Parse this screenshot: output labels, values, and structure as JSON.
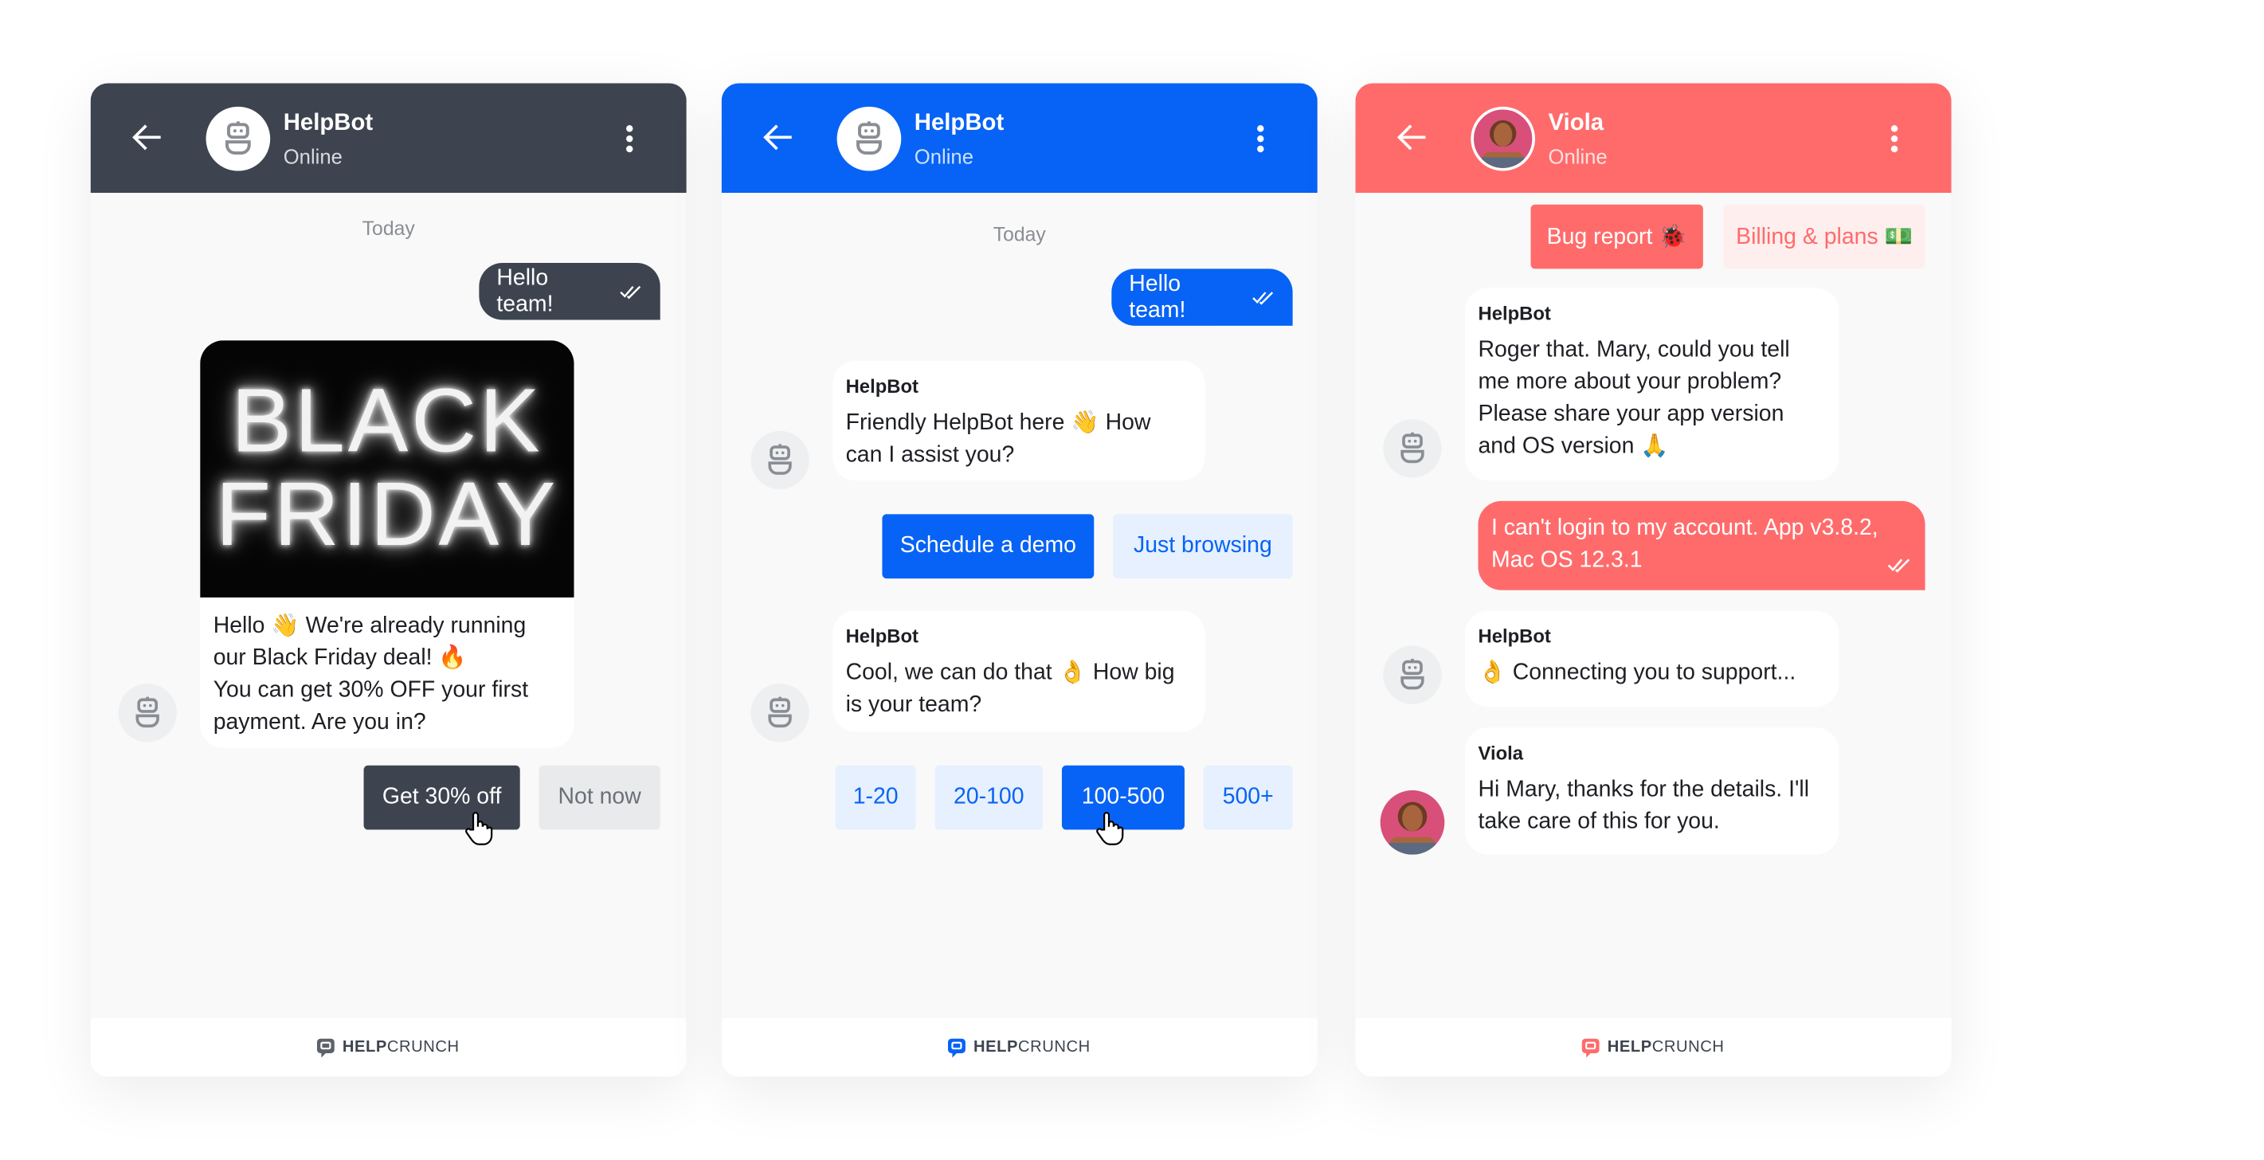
{
  "colors": {
    "dark": "#3d4450",
    "blue": "#0763f5",
    "coral": "#ff6b6b",
    "light_blue": "#e6f0ff",
    "light_pink": "#ffeeee",
    "light_grey": "#e9eaeb"
  },
  "brand": "HELPCRUNCH",
  "brand_parts": {
    "bold": "HELP",
    "regular": "CRUNCH"
  },
  "panels": [
    {
      "header": {
        "name": "HelpBot",
        "status": "Online"
      },
      "date_label": "Today",
      "user_message": "Hello team!",
      "promo_image_text": [
        "BLACK",
        "FRIDAY"
      ],
      "bot_message": [
        "Hello 👋 We're already running",
        "our Black Friday deal! 🔥",
        "You can get 30% OFF your first",
        "payment. Are you in?"
      ],
      "buttons": [
        "Get 30% off",
        "Not now"
      ]
    },
    {
      "header": {
        "name": "HelpBot",
        "status": "Online"
      },
      "date_label": "Today",
      "user_message": "Hello team!",
      "messages": [
        {
          "sender": "HelpBot",
          "lines": [
            "Friendly HelpBot here 👋  How",
            "can I assist you?"
          ]
        },
        {
          "sender": "HelpBot",
          "lines": [
            "Cool, we can do that 👌  How big",
            "is your team?"
          ]
        }
      ],
      "buttons_1": [
        "Schedule a demo",
        "Just browsing"
      ],
      "buttons_2": [
        "1-20",
        "20-100",
        "100-500",
        "500+"
      ]
    },
    {
      "header": {
        "name": "Viola",
        "status": "Online"
      },
      "buttons": [
        "Bug report 🐞",
        "Billing & plans 💵"
      ],
      "messages": [
        {
          "sender": "HelpBot",
          "lines": [
            "Roger that. Mary, could you tell",
            "me more about your problem?",
            "Please share your app version",
            "and OS version 🙏"
          ]
        },
        {
          "sender": "HelpBot",
          "lines": [
            "👌 Connecting you to support..."
          ]
        },
        {
          "sender": "Viola",
          "lines": [
            "Hi Mary, thanks for the details. I'll",
            "take care of this for you."
          ]
        }
      ],
      "user_message": [
        "I can't login to my account. App v3.8.2,",
        "Mac OS 12.3.1"
      ]
    }
  ]
}
